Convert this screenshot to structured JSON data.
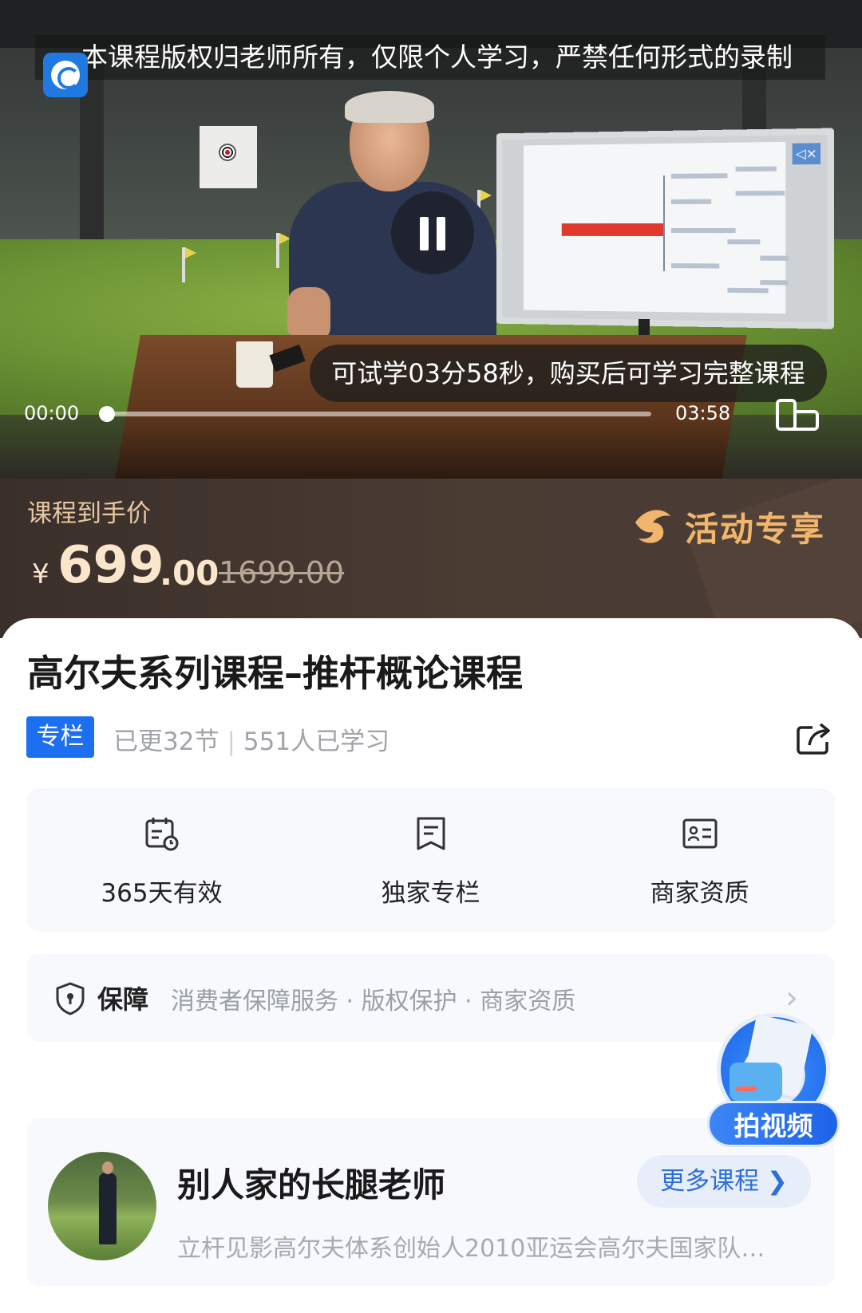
{
  "video": {
    "copyright_banner": "本课程版权归老师所有，仅限个人学习，严禁任何形式的录制",
    "trial_notice": "可试学03分58秒，购买后可学习完整课程",
    "time_current": "00:00",
    "time_total": "03:58",
    "progress": 0.0
  },
  "price": {
    "label": "课程到手价",
    "currency": "¥",
    "integer": "699",
    "decimal": ".00",
    "original": "1699.00",
    "promo_text": "活动专享"
  },
  "course": {
    "title": "高尔夫系列课程–推杆概论课程",
    "tag": "专栏",
    "updated": "已更32节",
    "learners": "551人已学习"
  },
  "features": [
    {
      "icon": "calendar-clock-icon",
      "label": "365天有效"
    },
    {
      "icon": "bookmark-doc-icon",
      "label": "独家专栏"
    },
    {
      "icon": "id-card-icon",
      "label": "商家资质"
    }
  ],
  "guarantee": {
    "title": "保障",
    "description": "消费者保障服务 · 版权保护 · 商家资质"
  },
  "fab": {
    "label": "拍视频"
  },
  "teacher": {
    "name": "别人家的长腿老师",
    "more_label": "更多课程 ❯",
    "description": "立杆见影高尔夫体系创始人2010亚运会高尔夫国家队…"
  },
  "colors": {
    "accent_blue": "#1d6ff2",
    "price_gold": "#fbe6cc",
    "promo_orange": "#f1b56c"
  }
}
